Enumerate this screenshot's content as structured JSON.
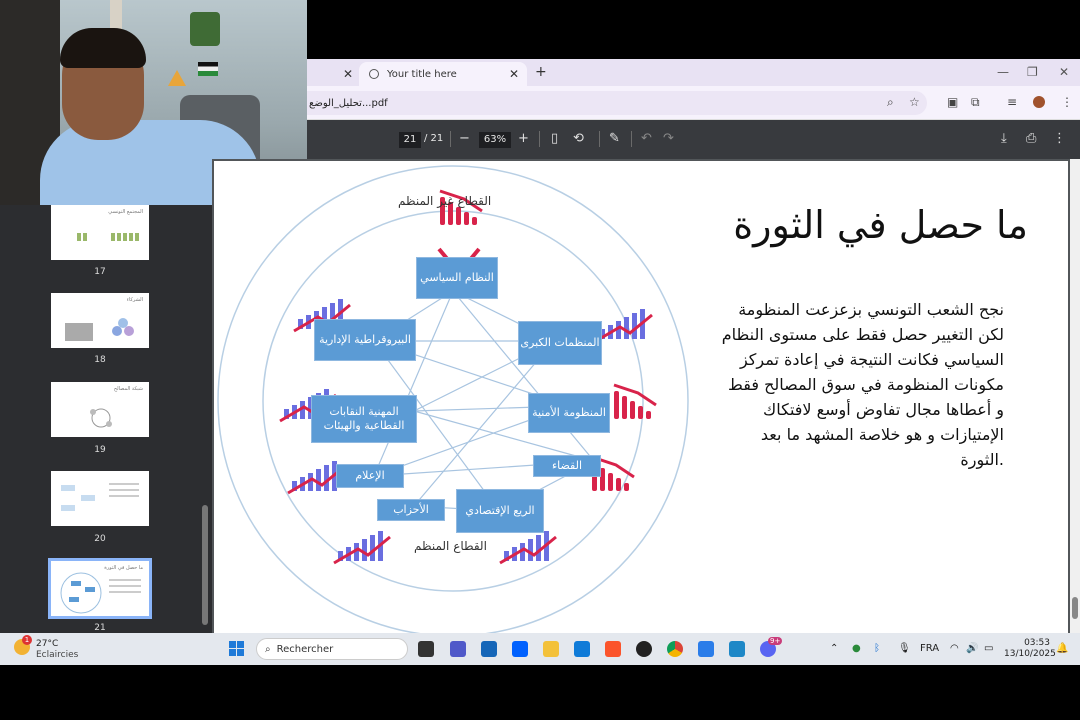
{
  "browser": {
    "tabs": [
      {
        "title": "",
        "active": false
      },
      {
        "title": "Your title here",
        "active": true
      }
    ],
    "new_tab": "+",
    "url": "تحليل_الوضع...pdf",
    "window_controls": {
      "minimize": "—",
      "restore": "❐",
      "close": "✕"
    }
  },
  "pdf_toolbar": {
    "page_current": "21",
    "page_total": "/ 21",
    "zoom": "63%",
    "zoom_out": "−",
    "zoom_in": "+"
  },
  "thumbnails": [
    {
      "page": "17",
      "title": "المجتمع التونسي"
    },
    {
      "page": "18",
      "title": "الشركاء"
    },
    {
      "page": "19",
      "title": "شبكة المصالح"
    },
    {
      "page": "20",
      "title": ""
    },
    {
      "page": "21",
      "title": "ما حصل في الثورة"
    }
  ],
  "slide": {
    "title": "ما حصل في الثورة",
    "body_lines": [
      "نجح الشعب التونسي بزعزعت المنظومة",
      "لكن التغيير حصل فقط على مستوى النظام",
      "السياسي فكانت النتيجة في إعادة تمركز",
      "مكونات المنظومة في سوق المصالح فقط",
      "و أعطاها مجال تفاوض أوسع لافتكاك",
      "الإمتيازات و هو خلاصة المشهد ما بعد",
      ".الثورة"
    ],
    "diagram": {
      "outer_top_label": "القطاع غير المنظم",
      "outer_bottom_label": "القطاع المنظم",
      "boxes": {
        "top": "النظام السياسي",
        "bureaucracy": "البيروقراطية الإدارية",
        "orgs": "المنظمات الكبرى",
        "unions": "المهنية النقابات القطاعية والهيئات",
        "security": "المنظومة الأمنية",
        "media": "الإعلام",
        "judiciary": "القضاء",
        "parties": "الأحزاب",
        "rent": "الريع الإقتصادي"
      }
    }
  },
  "taskbar": {
    "weather_temp": "27°C",
    "weather_desc": "Eclaircies",
    "weather_badge": "1",
    "search_placeholder": "Rechercher",
    "lang": "FRA",
    "time": "03:53",
    "date": "13/10/2025",
    "notif_badge": "9+"
  },
  "colors": {
    "box_blue": "#5b9bd5",
    "bar_purple": "#6a6ee0",
    "arrow_red": "#d8234a"
  }
}
